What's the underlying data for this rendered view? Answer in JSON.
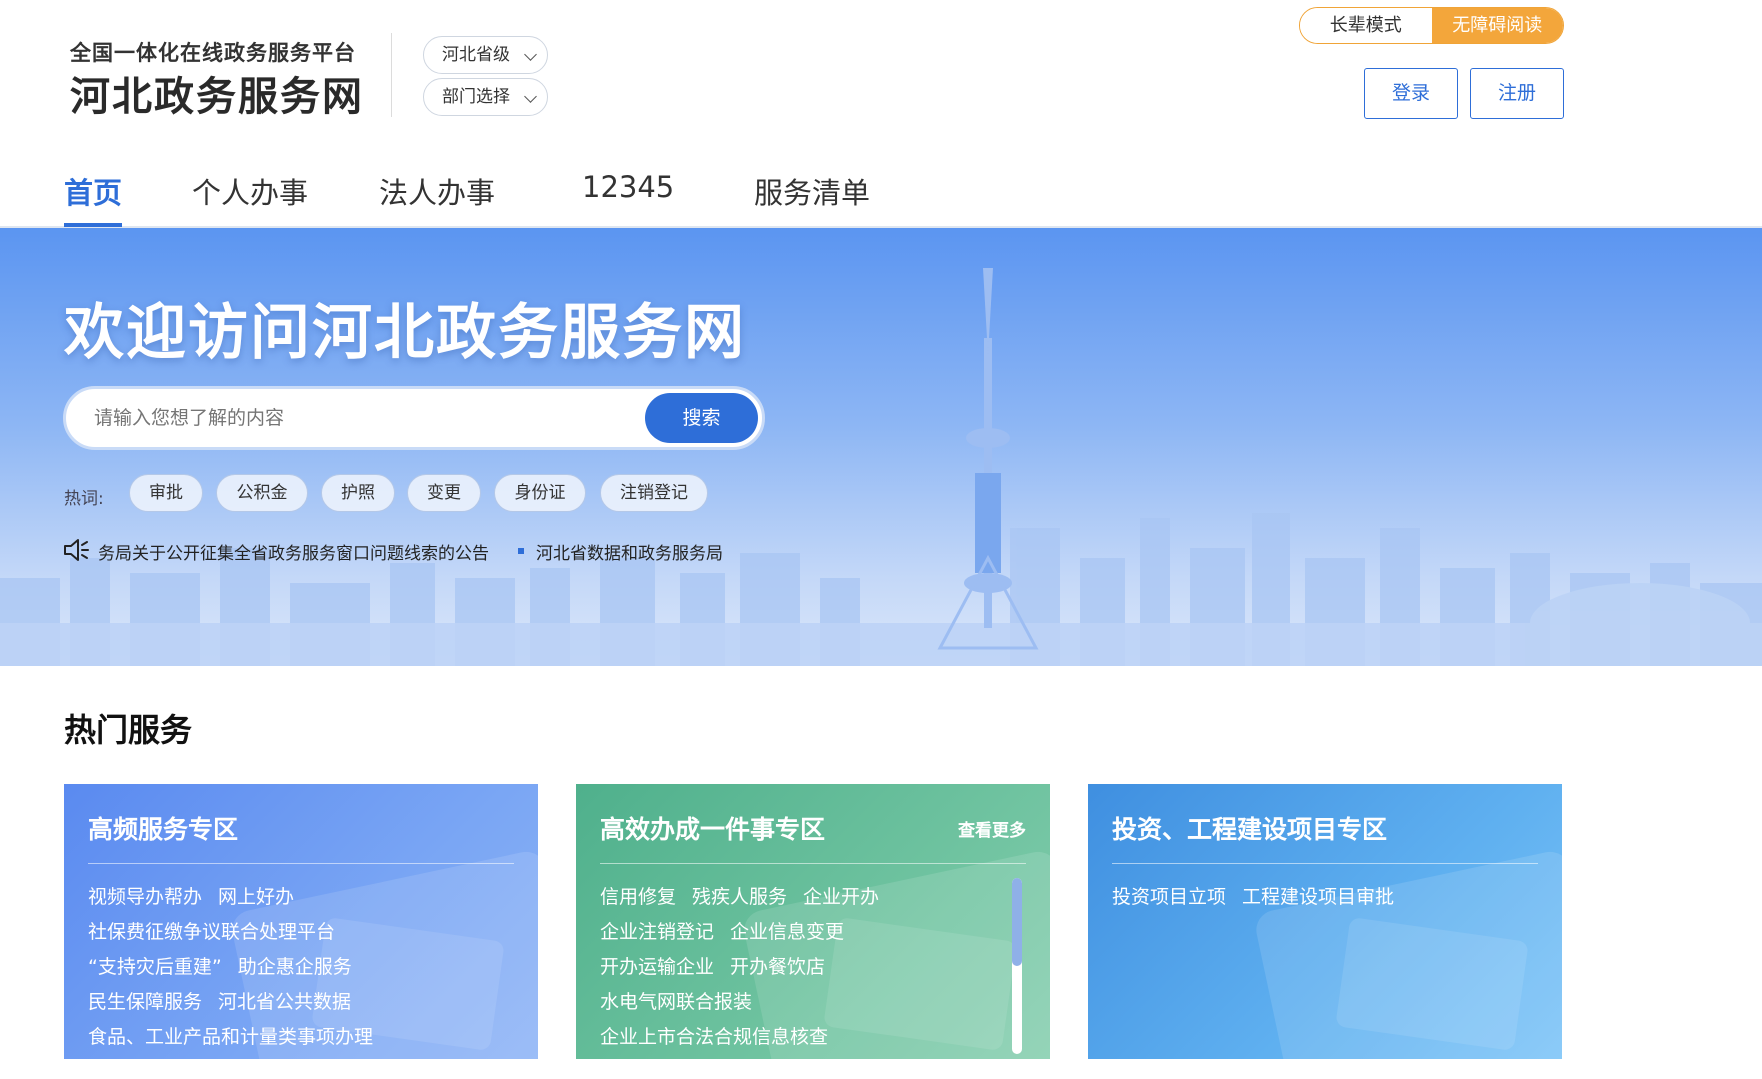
{
  "header": {
    "platform_subtitle": "全国一体化在线政务服务平台",
    "site_title": "河北政务服务网",
    "region_select": "河北省级",
    "department_select": "部门选择",
    "mode_elder": "长辈模式",
    "mode_accessible": "无障碍阅读",
    "login_label": "登录",
    "register_label": "注册"
  },
  "nav": {
    "items": [
      {
        "label": "首页"
      },
      {
        "label": "个人办事"
      },
      {
        "label": "法人办事"
      },
      {
        "label": "12345"
      },
      {
        "label": "服务清单"
      }
    ]
  },
  "hero": {
    "title": "欢迎访问河北政务服务网",
    "search_placeholder": "请输入您想了解的内容",
    "search_button": "搜索",
    "hot_label": "热词:",
    "hot_words": [
      "审批",
      "公积金",
      "护照",
      "变更",
      "身份证",
      "注销登记"
    ],
    "notice_text": "务局关于公开征集全省政务服务窗口问题线索的公告",
    "notice_source": "河北省数据和政务服务局"
  },
  "hot_services": {
    "title": "热门服务",
    "cards": [
      {
        "title": "高频服务专区",
        "rows": [
          [
            "视频导办帮办",
            "网上好办"
          ],
          [
            "社保费征缴争议联合处理平台"
          ],
          [
            "“支持灾后重建”",
            "助企惠企服务"
          ],
          [
            "民生保障服务",
            "河北省公共数据"
          ],
          [
            "食品、工业产品和计量类事项办理"
          ]
        ]
      },
      {
        "title": "高效办成一件事专区",
        "more": "查看更多",
        "rows": [
          [
            "信用修复",
            "残疾人服务",
            "企业开办"
          ],
          [
            "企业注销登记",
            "企业信息变更"
          ],
          [
            "开办运输企业",
            "开办餐饮店"
          ],
          [
            "水电气网联合报装"
          ],
          [
            "企业上市合法合规信息核查"
          ]
        ]
      },
      {
        "title": "投资、工程建设项目专区",
        "rows": [
          [
            "投资项目立项",
            "工程建设项目审批"
          ]
        ]
      }
    ]
  },
  "colors": {
    "primary": "#2e6ed8",
    "accent_orange": "#f3a63b",
    "card_blue": "#5a8af0",
    "card_green": "#4fb08c",
    "card_sky": "#3f8fe0"
  }
}
